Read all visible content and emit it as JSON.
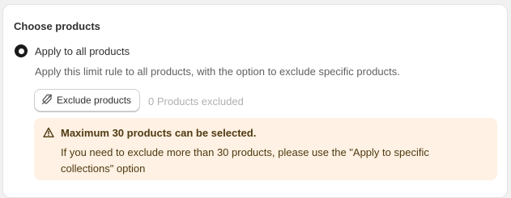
{
  "section": {
    "title": "Choose products"
  },
  "option": {
    "label": "Apply to all products",
    "help": "Apply this limit rule to all products, with the option to exclude specific products.",
    "selected": true
  },
  "exclude": {
    "button_label": "Exclude products",
    "button_icon": "tag-exclude-icon",
    "count_text": "0 Products excluded"
  },
  "warning": {
    "icon": "alert-triangle-icon",
    "title": "Maximum 30 products can be selected.",
    "text": "If you need to exclude more than 30 products, please use the \"Apply to specific collections\" option",
    "background": "#fff1e3",
    "text_color": "#4f3a12"
  }
}
